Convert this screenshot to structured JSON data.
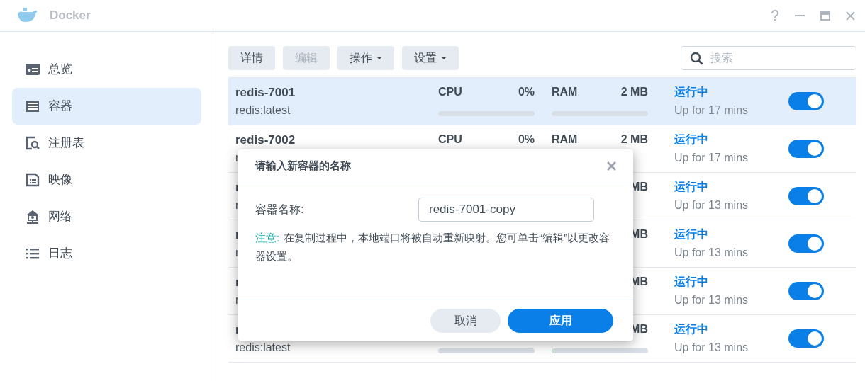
{
  "window": {
    "title": "Docker"
  },
  "sidebar": {
    "items": [
      {
        "label": "总览",
        "selected": false
      },
      {
        "label": "容器",
        "selected": true
      },
      {
        "label": "注册表",
        "selected": false
      },
      {
        "label": "映像",
        "selected": false
      },
      {
        "label": "网络",
        "selected": false
      },
      {
        "label": "日志",
        "selected": false
      }
    ]
  },
  "toolbar": {
    "buttons": [
      {
        "label": "详情",
        "disabled": false,
        "dropdown": false
      },
      {
        "label": "编辑",
        "disabled": true,
        "dropdown": false
      },
      {
        "label": "操作",
        "disabled": false,
        "dropdown": true
      },
      {
        "label": "设置",
        "disabled": false,
        "dropdown": true
      }
    ],
    "search": {
      "placeholder": "搜索"
    }
  },
  "containers": [
    {
      "name": "redis-7001",
      "image": "redis:latest",
      "cpu": {
        "label": "CPU",
        "value": "0%",
        "level": 0
      },
      "ram": {
        "label": "RAM",
        "value": "2 MB",
        "level": 0
      },
      "status": "运行中",
      "uptime": "Up for 17 mins",
      "on": true,
      "selected": true
    },
    {
      "name": "redis-7002",
      "image": "r",
      "cpu": {
        "label": "CPU",
        "value": "0%"
      },
      "ram": {
        "label": "RAM",
        "value": "2 MB"
      },
      "status": "运行中",
      "uptime": "Up for 17 mins",
      "on": true,
      "selected": false
    },
    {
      "name": "r",
      "image": "r",
      "ram": {
        "value": "MB"
      },
      "status": "运行中",
      "uptime": "Up for 13 mins",
      "on": true,
      "selected": false
    },
    {
      "name": "r",
      "image": "r",
      "ram": {
        "value": "MB"
      },
      "status": "运行中",
      "uptime": "Up for 13 mins",
      "on": true,
      "selected": false
    },
    {
      "name": "r",
      "image": "r",
      "ram": {
        "value": "MB"
      },
      "status": "运行中",
      "uptime": "Up for 13 mins",
      "on": true,
      "selected": false
    },
    {
      "name": "r",
      "image": "redis:latest",
      "cpu": {
        "level": 0
      },
      "ram": {
        "value": "MB",
        "level": 0.01
      },
      "status": "运行中",
      "uptime": "Up for 13 mins",
      "on": true,
      "selected": false
    }
  ],
  "dialog": {
    "title": "请输入新容器的名称",
    "field_label": "容器名称:",
    "field_value": "redis-7001-copy",
    "note_label": "注意:",
    "note_text": "在复制过程中，本地端口将被自动重新映射。您可单击“编辑”以更改容器设置。",
    "buttons": [
      {
        "label": "取消",
        "kind": "secondary"
      },
      {
        "label": "应用",
        "kind": "primary"
      }
    ]
  }
}
